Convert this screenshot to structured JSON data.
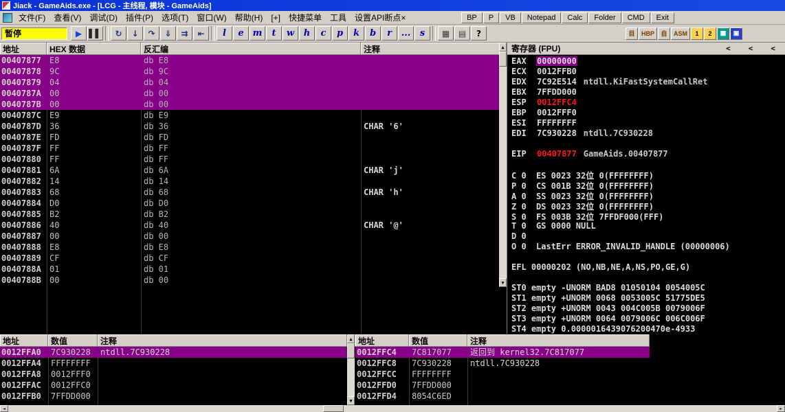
{
  "title": "Jiack - GameAids.exe - [LCG - 主线程, 模块 - GameAids]",
  "icons": {
    "up": "▲",
    "down": "▼",
    "left": "◄",
    "right": "►"
  },
  "menu": {
    "items": [
      "文件(F)",
      "查看(V)",
      "调试(D)",
      "插件(P)",
      "选项(T)",
      "窗口(W)",
      "帮助(H)",
      "[+]",
      "快捷菜单",
      "工具",
      "设置API断点×"
    ],
    "plugin_buttons": [
      "BP",
      "P",
      "VB",
      "Notepad",
      "Calc",
      "Folder",
      "CMD",
      "Exit"
    ]
  },
  "toolbar": {
    "status": "暂停",
    "buttons": [
      {
        "name": "run",
        "glyph": "▶",
        "color": "#1846d8"
      },
      {
        "name": "pause",
        "glyph": "▌▌",
        "color": "#282828"
      },
      {
        "sep": true
      },
      {
        "name": "restart",
        "glyph": "↻",
        "color": "#1b2f86"
      },
      {
        "name": "step-into",
        "glyph": "↓",
        "color": "#1b2f86"
      },
      {
        "name": "step-over",
        "glyph": "↷",
        "color": "#1b2f86"
      },
      {
        "name": "animate-into",
        "glyph": "⇓",
        "color": "#1b2f86"
      },
      {
        "name": "animate-over",
        "glyph": "⇉",
        "color": "#1b2f86"
      },
      {
        "name": "execute-till-return",
        "glyph": "⇤",
        "color": "#1b2f86"
      },
      {
        "sep": true
      },
      {
        "name": "log-window",
        "glyph": "l",
        "letter": true
      },
      {
        "name": "executables-window",
        "glyph": "e",
        "letter": true
      },
      {
        "name": "memory-window",
        "glyph": "m",
        "letter": true
      },
      {
        "name": "threads-window",
        "glyph": "t",
        "letter": true
      },
      {
        "name": "windows-window",
        "glyph": "w",
        "letter": true
      },
      {
        "name": "handles-window",
        "glyph": "h",
        "letter": true
      },
      {
        "name": "cpu-window",
        "glyph": "c",
        "letter": true
      },
      {
        "name": "patches-window",
        "glyph": "p",
        "letter": true
      },
      {
        "name": "call-stack-window",
        "glyph": "k",
        "letter": true
      },
      {
        "name": "breakpoints-window",
        "glyph": "b",
        "letter": true
      },
      {
        "name": "references-window",
        "glyph": "r",
        "letter": true
      },
      {
        "name": "run-trace-window",
        "glyph": "...",
        "letter": true
      },
      {
        "name": "source-window",
        "glyph": "s",
        "letter": true
      },
      {
        "sep": true
      },
      {
        "name": "windows-list",
        "glyph": "▦",
        "color": "#3a3a3a"
      },
      {
        "name": "appearance",
        "glyph": "▤",
        "color": "#3a3a3a"
      },
      {
        "name": "help",
        "glyph": "?",
        "color": "#000000"
      }
    ],
    "right_buttons": [
      {
        "label": "目",
        "fg": "#7a3c00",
        "bg": "#d4d0c8"
      },
      {
        "label": "HBP",
        "fg": "#7a3c00",
        "bg": "#d4d0c8"
      },
      {
        "label": "自",
        "fg": "#7a3c00",
        "bg": "#d4d0c8"
      },
      {
        "label": "ASM",
        "fg": "#7a3c00",
        "bg": "#d4d0c8"
      },
      {
        "label": "1",
        "fg": "#000000",
        "bg": "#ffd24a"
      },
      {
        "label": "2",
        "fg": "#000000",
        "bg": "#ffd24a"
      },
      {
        "label": "▦",
        "fg": "#ffffff",
        "bg": "#0a9a8e"
      },
      {
        "label": "▣",
        "fg": "#ffffff",
        "bg": "#2a3cc8"
      }
    ]
  },
  "disasm": {
    "headers": [
      "地址",
      "HEX 数据",
      "反汇编",
      "注释"
    ],
    "rows": [
      {
        "addr": "00407877",
        "hex": "E8",
        "disasm": "db E8",
        "comment": "",
        "selected": true
      },
      {
        "addr": "00407878",
        "hex": "9C",
        "disasm": "db 9C",
        "comment": "",
        "selected": true
      },
      {
        "addr": "00407879",
        "hex": "04",
        "disasm": "db 04",
        "comment": "",
        "selected": true
      },
      {
        "addr": "0040787A",
        "hex": "00",
        "disasm": "db 00",
        "comment": "",
        "selected": true
      },
      {
        "addr": "0040787B",
        "hex": "00",
        "disasm": "db 00",
        "comment": "",
        "selected": true
      },
      {
        "addr": "0040787C",
        "hex": "E9",
        "disasm": "db E9",
        "comment": ""
      },
      {
        "addr": "0040787D",
        "hex": "36",
        "disasm": "db 36",
        "comment": "CHAR '6'"
      },
      {
        "addr": "0040787E",
        "hex": "FD",
        "disasm": "db FD",
        "comment": ""
      },
      {
        "addr": "0040787F",
        "hex": "FF",
        "disasm": "db FF",
        "comment": ""
      },
      {
        "addr": "00407880",
        "hex": "FF",
        "disasm": "db FF",
        "comment": ""
      },
      {
        "addr": "00407881",
        "hex": "6A",
        "disasm": "db 6A",
        "comment": "CHAR 'j'"
      },
      {
        "addr": "00407882",
        "hex": "14",
        "disasm": "db 14",
        "comment": ""
      },
      {
        "addr": "00407883",
        "hex": "68",
        "disasm": "db 68",
        "comment": "CHAR 'h'"
      },
      {
        "addr": "00407884",
        "hex": "D0",
        "disasm": "db D0",
        "comment": ""
      },
      {
        "addr": "00407885",
        "hex": "B2",
        "disasm": "db B2",
        "comment": ""
      },
      {
        "addr": "00407886",
        "hex": "40",
        "disasm": "db 40",
        "comment": "CHAR '@'"
      },
      {
        "addr": "00407887",
        "hex": "00",
        "disasm": "db 00",
        "comment": ""
      },
      {
        "addr": "00407888",
        "hex": "E8",
        "disasm": "db E8",
        "comment": ""
      },
      {
        "addr": "00407889",
        "hex": "CF",
        "disasm": "db CF",
        "comment": ""
      },
      {
        "addr": "0040788A",
        "hex": "01",
        "disasm": "db 01",
        "comment": ""
      },
      {
        "addr": "0040788B",
        "hex": "00",
        "disasm": "db 00",
        "comment": ""
      }
    ]
  },
  "registers": {
    "title": "寄存器 (FPU)",
    "nav": [
      "<",
      "<",
      "<"
    ],
    "lines": [
      {
        "t": "reg",
        "n": "EAX",
        "v": "00000000",
        "sel": true
      },
      {
        "t": "reg",
        "n": "ECX",
        "v": "0012FFB0"
      },
      {
        "t": "reg",
        "n": "EDX",
        "v": "7C92E514",
        "c": "ntdll.KiFastSystemCallRet"
      },
      {
        "t": "reg",
        "n": "EBX",
        "v": "7FFDD000"
      },
      {
        "t": "reg",
        "n": "ESP",
        "v": "0012FFC4",
        "red": true
      },
      {
        "t": "reg",
        "n": "EBP",
        "v": "0012FFF0"
      },
      {
        "t": "reg",
        "n": "ESI",
        "v": "FFFFFFFF"
      },
      {
        "t": "reg",
        "n": "EDI",
        "v": "7C930228",
        "c": "ntdll.7C930228"
      },
      {
        "t": "blank"
      },
      {
        "t": "reg",
        "n": "EIP",
        "v": "00407877",
        "red": true,
        "c": "GameAids.00407877"
      },
      {
        "t": "blank"
      },
      {
        "t": "flag",
        "f": "C 0",
        "r": "ES 0023 32位 0(FFFFFFFF)"
      },
      {
        "t": "flag",
        "f": "P 0",
        "r": "CS 001B 32位 0(FFFFFFFF)"
      },
      {
        "t": "flag",
        "f": "A 0",
        "r": "SS 0023 32位 0(FFFFFFFF)"
      },
      {
        "t": "flag",
        "f": "Z 0",
        "r": "DS 0023 32位 0(FFFFFFFF)"
      },
      {
        "t": "flag",
        "f": "S 0",
        "r": "FS 003B 32位 7FFDF000(FFF)"
      },
      {
        "t": "flag",
        "f": "T 0",
        "r": "GS 0000 NULL"
      },
      {
        "t": "flag",
        "f": "D 0",
        "r": ""
      },
      {
        "t": "flag",
        "f": "O 0",
        "r": "LastErr ERROR_INVALID_HANDLE (00000006)"
      },
      {
        "t": "blank"
      },
      {
        "t": "plain",
        "x": "EFL 00000202 (NO,NB,NE,A,NS,PO,GE,G)"
      },
      {
        "t": "blank"
      },
      {
        "t": "plain",
        "x": "ST0 empty -UNORM BAD8 01050104 0054005C"
      },
      {
        "t": "plain",
        "x": "ST1 empty +UNORM 0068 0053005C 51775DE5"
      },
      {
        "t": "plain",
        "x": "ST2 empty +UNORM 0043 004C005B 0079006F"
      },
      {
        "t": "plain",
        "x": "ST3 empty +UNORM 0064 0079006C 006C006F"
      },
      {
        "t": "plain",
        "x": "ST4 empty 0.0000016439076200470e-4933"
      }
    ]
  },
  "stack_left": {
    "headers": [
      "地址",
      "数值",
      "注释"
    ],
    "rows": [
      {
        "addr": "0012FFA0",
        "val": "7C930228",
        "comment": "ntdll.7C930228",
        "selected": true
      },
      {
        "addr": "0012FFA4",
        "val": "FFFFFFFF",
        "comment": ""
      },
      {
        "addr": "0012FFA8",
        "val": "0012FFF0",
        "comment": ""
      },
      {
        "addr": "0012FFAC",
        "val": "0012FFC0",
        "comment": ""
      },
      {
        "addr": "0012FFB0",
        "val": "7FFDD000",
        "comment": ""
      }
    ]
  },
  "stack_right": {
    "headers": [
      "地址",
      "数值",
      "注释"
    ],
    "rows": [
      {
        "addr": "0012FFC4",
        "val": "7C817077",
        "comment": "返回到 kernel32.7C817077",
        "selected": true
      },
      {
        "addr": "0012FFC8",
        "val": "7C930228",
        "comment": "ntdll.7C930228"
      },
      {
        "addr": "0012FFCC",
        "val": "FFFFFFFF",
        "comment": ""
      },
      {
        "addr": "0012FFD0",
        "val": "7FFDD000",
        "comment": ""
      },
      {
        "addr": "0012FFD4",
        "val": "8054C6ED",
        "comment": ""
      }
    ]
  }
}
